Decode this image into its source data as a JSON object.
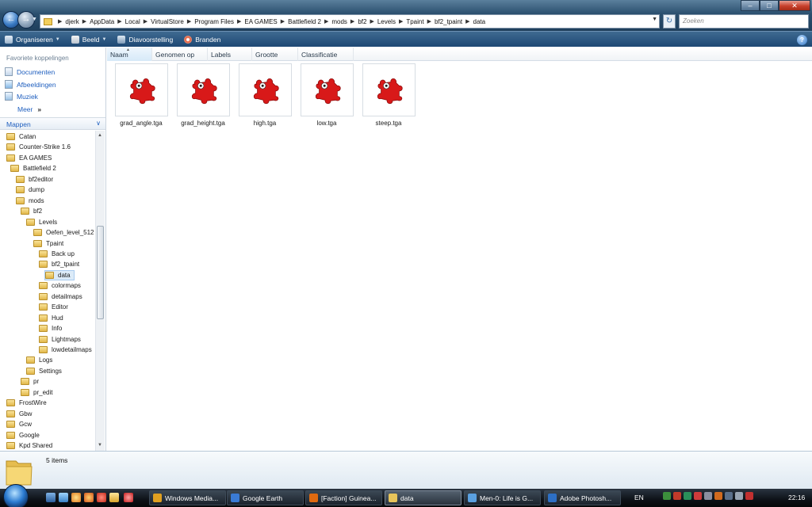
{
  "address": {
    "crumbs": [
      "djerk",
      "AppData",
      "Local",
      "VirtualStore",
      "Program Files",
      "EA GAMES",
      "Battlefield 2",
      "mods",
      "bf2",
      "Levels",
      "Tpaint",
      "bf2_tpaint",
      "data"
    ],
    "search_placeholder": "Zoeken"
  },
  "toolbar": {
    "organize": "Organiseren",
    "view": "Beeld",
    "slideshow": "Diavoorstelling",
    "burn": "Branden",
    "help": "?"
  },
  "favorites": {
    "title": "Favoriete koppelingen",
    "items": [
      "Documenten",
      "Afbeeldingen",
      "Muziek"
    ],
    "more": "Meer"
  },
  "folders_title": "Mappen",
  "tree": [
    {
      "label": "Catan",
      "level": 0
    },
    {
      "label": "Counter-Strike 1.6",
      "level": 0
    },
    {
      "label": "EA GAMES",
      "level": 0
    },
    {
      "label": "Battlefield 2",
      "level": 1
    },
    {
      "label": "bf2editor",
      "level": 2
    },
    {
      "label": "dump",
      "level": 2
    },
    {
      "label": "mods",
      "level": 2
    },
    {
      "label": "bf2",
      "level": 3
    },
    {
      "label": "Levels",
      "level": 4
    },
    {
      "label": "Oefen_level_512",
      "level": 5
    },
    {
      "label": "Tpaint",
      "level": 5
    },
    {
      "label": "Back up",
      "level": 6
    },
    {
      "label": "bf2_tpaint",
      "level": 6
    },
    {
      "label": "data",
      "level": 7,
      "selected": true
    },
    {
      "label": "colormaps",
      "level": 6
    },
    {
      "label": "detailmaps",
      "level": 6
    },
    {
      "label": "Editor",
      "level": 6
    },
    {
      "label": "Hud",
      "level": 6
    },
    {
      "label": "Info",
      "level": 6
    },
    {
      "label": "Lightmaps",
      "level": 6
    },
    {
      "label": "lowdetailmaps",
      "level": 6
    },
    {
      "label": "Logs",
      "level": 4
    },
    {
      "label": "Settings",
      "level": 4
    },
    {
      "label": "pr",
      "level": 3
    },
    {
      "label": "pr_edit",
      "level": 3
    },
    {
      "label": "FrostWire",
      "level": 0
    },
    {
      "label": "Gbw",
      "level": 0
    },
    {
      "label": "Gcw",
      "level": 0
    },
    {
      "label": "Google",
      "level": 0
    },
    {
      "label": "Kpd Shared",
      "level": 0
    }
  ],
  "columns": [
    "Naam",
    "Genomen op",
    "Labels",
    "Grootte",
    "Classificatie"
  ],
  "files": [
    "grad_angle.tga",
    "grad_height.tga",
    "high.tga",
    "low.tga",
    "steep.tga"
  ],
  "status": {
    "count": "5 items"
  },
  "taskbar": {
    "tasks": [
      {
        "label": "Windows Media...",
        "color": "#e0a020"
      },
      {
        "label": "Google Earth",
        "color": "#3a7bd5"
      },
      {
        "label": "[Faction] Guinea...",
        "color": "#e06a10"
      },
      {
        "label": "data",
        "color": "#e7c45a",
        "active": true
      },
      {
        "label": "Men-0: Life is G...",
        "color": "#5aa0e0"
      },
      {
        "label": "Adobe Photosh...",
        "color": "#2d6fc4"
      }
    ],
    "language": "EN",
    "clock": "22:16"
  },
  "colors": {
    "accent": "#1f5fbf",
    "toolbar": "#1d4874",
    "selection": "#dcebf8"
  }
}
